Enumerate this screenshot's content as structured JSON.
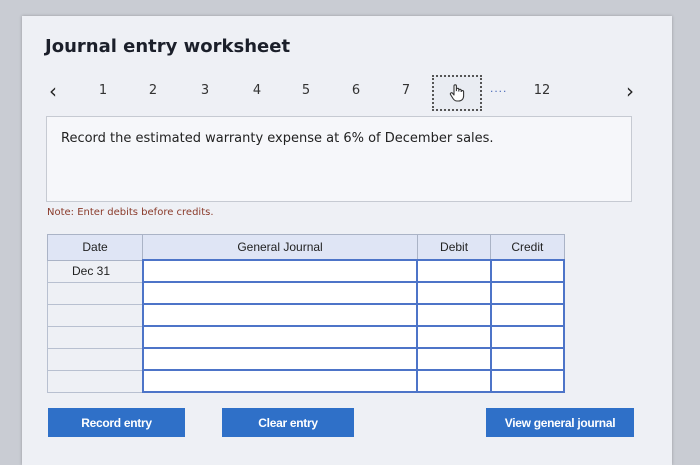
{
  "title": "Journal entry worksheet",
  "nav": {
    "prev_icon": "‹",
    "next_icon": "›",
    "pages": [
      "1",
      "2",
      "3",
      "4",
      "5",
      "6",
      "7"
    ],
    "current_icon": "hand-pointer",
    "ellipsis": "....",
    "last_page": "12"
  },
  "question": "Record the estimated warranty expense at 6% of December sales.",
  "note": "Note: Enter debits before credits.",
  "table": {
    "headers": {
      "date": "Date",
      "journal": "General Journal",
      "debit": "Debit",
      "credit": "Credit"
    },
    "rows": [
      {
        "date": "Dec 31"
      },
      {
        "date": ""
      },
      {
        "date": ""
      },
      {
        "date": ""
      },
      {
        "date": ""
      },
      {
        "date": ""
      }
    ]
  },
  "buttons": {
    "record": "Record entry",
    "clear": "Clear entry",
    "view": "View general journal"
  },
  "colors": {
    "accent": "#2f70c8",
    "header_bg": "#dfe5f5",
    "input_border": "#4d74c8"
  }
}
